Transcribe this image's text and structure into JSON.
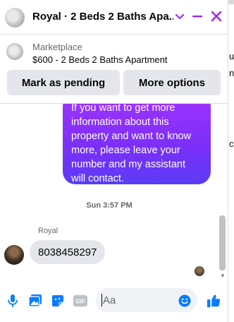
{
  "header": {
    "title": "Royal · 2 Beds 2 Baths Apa...",
    "accent": "#a020f0"
  },
  "listing": {
    "tag": "Marketplace",
    "summary": "$600 - 2 Beds 2 Baths Apartment",
    "buttons": {
      "mark_pending": "Mark as pending",
      "more_options": "More options"
    }
  },
  "conversation": {
    "outgoing": {
      "lines": [
        "If you want to get more",
        "information about this",
        "property and want to know",
        "more, please leave your",
        "number and my assistant",
        "will contact."
      ]
    },
    "timestamp": "Sun 3:57 PM",
    "incoming": {
      "sender": "Royal",
      "text": "8038458297"
    }
  },
  "composer": {
    "placeholder": "Aa",
    "icons": [
      "microphone-icon",
      "photo-icon",
      "sticker-icon",
      "gif-icon",
      "emoji-icon",
      "like-icon"
    ]
  },
  "side": {
    "chars": [
      "u",
      "n",
      "c"
    ]
  }
}
